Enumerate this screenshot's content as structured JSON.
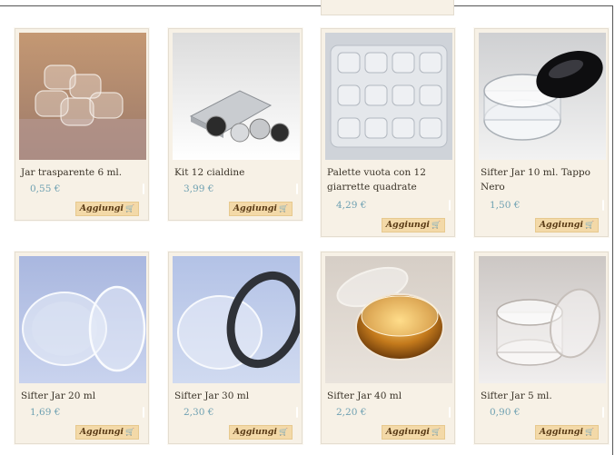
{
  "products": [
    {
      "title": "Jar trasparente 6 ml.",
      "price": "0,55 €",
      "button": "Aggiungi",
      "cart_icon": "cart-icon"
    },
    {
      "title": "Kit 12 cialdine",
      "price": "3,99 €",
      "button": "Aggiungi",
      "cart_icon": "cart-icon"
    },
    {
      "title": "Palette vuota con 12 giarrette quadrate",
      "price": "4,29 €",
      "button": "Aggiungi",
      "cart_icon": "cart-icon"
    },
    {
      "title": "Sifter Jar 10 ml. Tappo Nero",
      "price": "1,50 €",
      "button": "Aggiungi",
      "cart_icon": "cart-icon"
    },
    {
      "title": "Sifter Jar 20 ml",
      "price": "1,69 €",
      "button": "Aggiungi",
      "cart_icon": "cart-icon"
    },
    {
      "title": "Sifter Jar 30 ml",
      "price": "2,30 €",
      "button": "Aggiungi",
      "cart_icon": "cart-icon"
    },
    {
      "title": "Sifter Jar 40 ml",
      "price": "2,20 €",
      "button": "Aggiungi",
      "cart_icon": "cart-icon"
    },
    {
      "title": "Sifter Jar 5 ml.",
      "price": "0,90 €",
      "button": "Aggiungi",
      "cart_icon": "cart-icon"
    }
  ],
  "colors": {
    "card_background": "#f7f1e6",
    "price_text": "#6fa1b2",
    "button_background": "#f3d9a8",
    "button_text": "#5a3b16"
  }
}
